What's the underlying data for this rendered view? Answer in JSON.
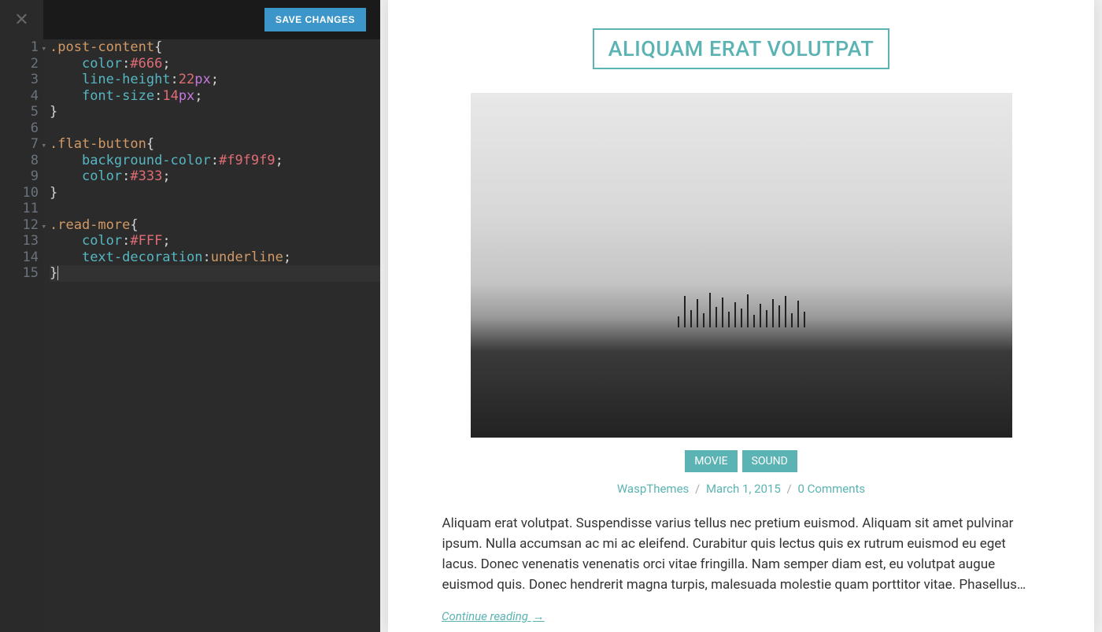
{
  "toolbar": {
    "save_label": "SAVE CHANGES"
  },
  "editor": {
    "lines": [
      {
        "n": 1,
        "fold": true,
        "tokens": [
          [
            ".post-content",
            "sel"
          ],
          [
            "{",
            "brace"
          ]
        ]
      },
      {
        "n": 2,
        "fold": false,
        "tokens": [
          [
            "    ",
            ""
          ],
          [
            "color",
            "prop"
          ],
          [
            ":",
            "punct"
          ],
          [
            "#666",
            "val"
          ],
          [
            ";",
            "punct"
          ]
        ]
      },
      {
        "n": 3,
        "fold": false,
        "tokens": [
          [
            "    ",
            ""
          ],
          [
            "line-height",
            "prop"
          ],
          [
            ":",
            "punct"
          ],
          [
            "22",
            "num"
          ],
          [
            "px",
            "unit"
          ],
          [
            ";",
            "punct"
          ]
        ]
      },
      {
        "n": 4,
        "fold": false,
        "tokens": [
          [
            "    ",
            ""
          ],
          [
            "font-size",
            "prop"
          ],
          [
            ":",
            "punct"
          ],
          [
            "14",
            "num"
          ],
          [
            "px",
            "unit"
          ],
          [
            ";",
            "punct"
          ]
        ]
      },
      {
        "n": 5,
        "fold": false,
        "tokens": [
          [
            "}",
            "brace"
          ]
        ]
      },
      {
        "n": 6,
        "fold": false,
        "tokens": []
      },
      {
        "n": 7,
        "fold": true,
        "tokens": [
          [
            ".flat-button",
            "sel"
          ],
          [
            "{",
            "brace"
          ]
        ]
      },
      {
        "n": 8,
        "fold": false,
        "tokens": [
          [
            "    ",
            ""
          ],
          [
            "background-color",
            "prop"
          ],
          [
            ":",
            "punct"
          ],
          [
            "#f9f9f9",
            "val"
          ],
          [
            ";",
            "punct"
          ]
        ]
      },
      {
        "n": 9,
        "fold": false,
        "tokens": [
          [
            "    ",
            ""
          ],
          [
            "color",
            "prop"
          ],
          [
            ":",
            "punct"
          ],
          [
            "#333",
            "val"
          ],
          [
            ";",
            "punct"
          ]
        ]
      },
      {
        "n": 10,
        "fold": false,
        "tokens": [
          [
            "}",
            "brace"
          ]
        ]
      },
      {
        "n": 11,
        "fold": false,
        "tokens": []
      },
      {
        "n": 12,
        "fold": true,
        "tokens": [
          [
            ".read-more",
            "sel"
          ],
          [
            "{",
            "brace"
          ]
        ]
      },
      {
        "n": 13,
        "fold": false,
        "tokens": [
          [
            "    ",
            ""
          ],
          [
            "color",
            "prop"
          ],
          [
            ":",
            "punct"
          ],
          [
            "#FFF",
            "val"
          ],
          [
            ";",
            "punct"
          ]
        ]
      },
      {
        "n": 14,
        "fold": false,
        "tokens": [
          [
            "    ",
            ""
          ],
          [
            "text-decoration",
            "prop"
          ],
          [
            ":",
            "punct"
          ],
          [
            "underline",
            "kw"
          ],
          [
            ";",
            "punct"
          ]
        ]
      },
      {
        "n": 15,
        "fold": false,
        "tokens": [
          [
            "}",
            "brace"
          ]
        ],
        "active": true,
        "cursor_after": 0
      }
    ]
  },
  "preview": {
    "post_title": "ALIQUAM ERAT VOLUTPAT",
    "categories": [
      "MOVIE",
      "SOUND"
    ],
    "author": "WaspThemes",
    "date": "March 1, 2015",
    "comments": "0 Comments",
    "sep": "/",
    "excerpt": "Aliquam erat volutpat. Suspendisse varius tellus nec pretium euismod. Aliquam sit amet pulvinar ipsum. Nulla accumsan ac mi ac eleifend. Curabitur quis lectus quis ex rutrum euismod eu eget lacus. Donec venenatis venenatis orci vitae fringilla. Nam semper diam est, eu volutpat augue euismod quis. Donec hendrerit magna turpis, malesuada molestie quam porttitor vitae. Phasellus…",
    "read_more": "Continue reading",
    "read_more_arrow": "→"
  }
}
